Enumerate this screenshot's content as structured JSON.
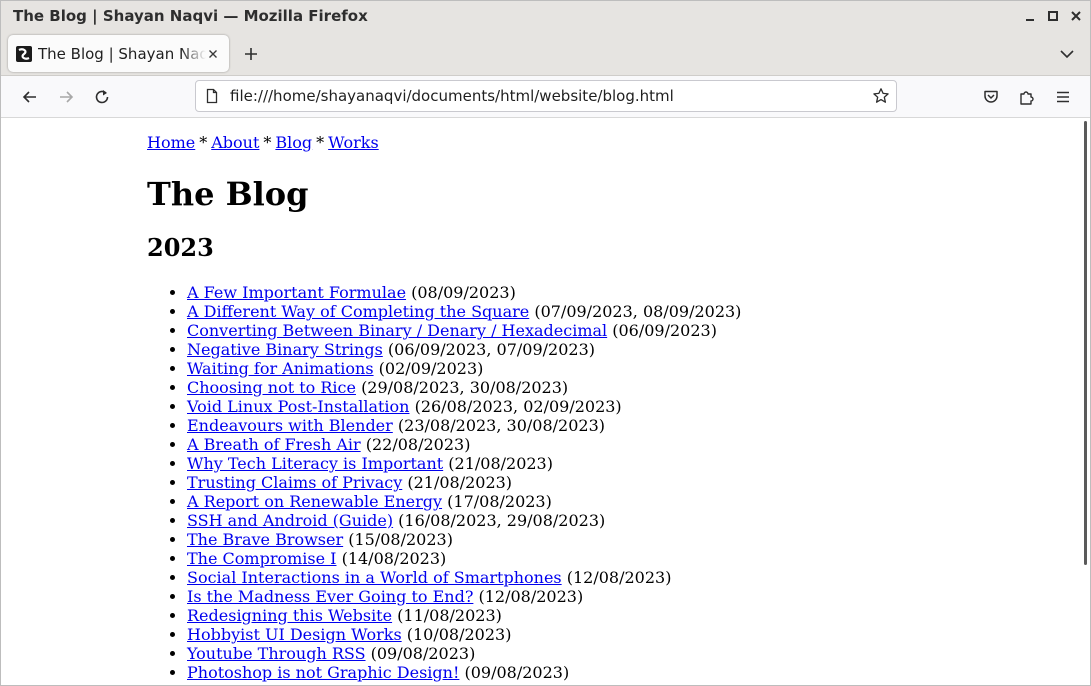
{
  "window": {
    "title": "The Blog | Shayan Naqvi — Mozilla Firefox"
  },
  "tab": {
    "label": "The Blog | Shayan Naqvi",
    "favicon": "shayan-logo-icon"
  },
  "navbar": {
    "url": "file:///home/shayanaqvi/documents/html/website/blog.html"
  },
  "site_nav": {
    "items": [
      "Home",
      "About",
      "Blog",
      "Works"
    ],
    "separator": "*"
  },
  "page": {
    "title": "The Blog",
    "year": "2023"
  },
  "posts": [
    {
      "title": "A Few Important Formulae",
      "dates": "(08/09/2023)"
    },
    {
      "title": "A Different Way of Completing the Square",
      "dates": "(07/09/2023, 08/09/2023)"
    },
    {
      "title": "Converting Between Binary / Denary / Hexadecimal",
      "dates": "(06/09/2023)"
    },
    {
      "title": "Negative Binary Strings",
      "dates": "(06/09/2023, 07/09/2023)"
    },
    {
      "title": "Waiting for Animations",
      "dates": "(02/09/2023)"
    },
    {
      "title": "Choosing not to Rice",
      "dates": "(29/08/2023, 30/08/2023)"
    },
    {
      "title": "Void Linux Post-Installation",
      "dates": "(26/08/2023, 02/09/2023)"
    },
    {
      "title": "Endeavours with Blender",
      "dates": "(23/08/2023, 30/08/2023)"
    },
    {
      "title": "A Breath of Fresh Air",
      "dates": "(22/08/2023)"
    },
    {
      "title": "Why Tech Literacy is Important",
      "dates": "(21/08/2023)"
    },
    {
      "title": "Trusting Claims of Privacy",
      "dates": "(21/08/2023)"
    },
    {
      "title": "A Report on Renewable Energy",
      "dates": "(17/08/2023)"
    },
    {
      "title": "SSH and Android (Guide)",
      "dates": "(16/08/2023, 29/08/2023)"
    },
    {
      "title": "The Brave Browser",
      "dates": "(15/08/2023)"
    },
    {
      "title": "The Compromise I",
      "dates": "(14/08/2023)"
    },
    {
      "title": "Social Interactions in a World of Smartphones",
      "dates": "(12/08/2023)"
    },
    {
      "title": "Is the Madness Ever Going to End?",
      "dates": "(12/08/2023)"
    },
    {
      "title": "Redesigning this Website",
      "dates": "(11/08/2023)"
    },
    {
      "title": "Hobbyist UI Design Works",
      "dates": "(10/08/2023)"
    },
    {
      "title": "Youtube Through RSS",
      "dates": "(09/08/2023)"
    },
    {
      "title": "Photoshop is not Graphic Design!",
      "dates": "(09/08/2023)"
    }
  ],
  "colors": {
    "link": "#0000ee",
    "chrome": "#e6e4e1",
    "toolbar": "#f9f9fb"
  }
}
